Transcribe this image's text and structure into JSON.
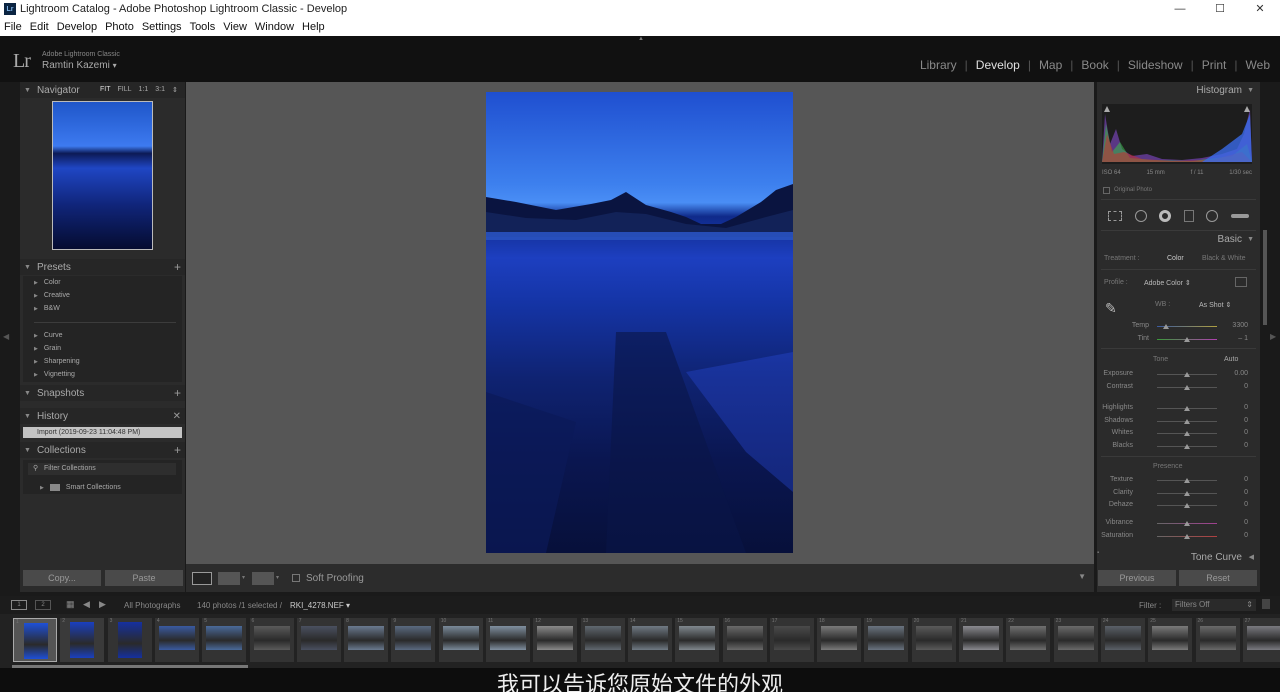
{
  "window": {
    "title": "Lightroom Catalog - Adobe Photoshop Lightroom Classic - Develop",
    "icon_label": "Lr",
    "controls": [
      "—",
      "☐",
      "✕"
    ]
  },
  "menu": [
    "File",
    "Edit",
    "Develop",
    "Photo",
    "Settings",
    "Tools",
    "View",
    "Window",
    "Help"
  ],
  "identity": {
    "logo": "Lr",
    "product": "Adobe Lightroom Classic",
    "user": "Ramtin Kazemi",
    "user_arrow": "▾"
  },
  "modules": {
    "items": [
      "Library",
      "Develop",
      "Map",
      "Book",
      "Slideshow",
      "Print",
      "Web"
    ],
    "active": "Develop"
  },
  "left": {
    "navigator": {
      "title": "Navigator",
      "zoom": [
        "FIT",
        "FILL",
        "1:1",
        "3:1"
      ],
      "zoom_arrow": "⇕"
    },
    "presets": {
      "title": "Presets",
      "groups_a": [
        "Color",
        "Creative",
        "B&W"
      ],
      "groups_b": [
        "Curve",
        "Grain",
        "Sharpening",
        "Vignetting"
      ]
    },
    "snapshots": {
      "title": "Snapshots"
    },
    "history": {
      "title": "History",
      "item": "Import (2019-09-23 11:04:48 PM)"
    },
    "collections": {
      "title": "Collections",
      "filter": "Filter Collections",
      "smart": "Smart Collections"
    },
    "copy": "Copy...",
    "paste": "Paste"
  },
  "toolbar": {
    "soft_proofing": "Soft Proofing"
  },
  "right": {
    "histogram": {
      "title": "Histogram",
      "iso": "ISO 64",
      "focal": "15 mm",
      "aperture": "f / 11",
      "shutter": "1/30 sec",
      "original": "Original Photo"
    },
    "basic": {
      "title": "Basic",
      "treatment_label": "Treatment :",
      "color": "Color",
      "bw": "Black & White",
      "profile_label": "Profile :",
      "profile": "Adobe Color",
      "wb_label": "WB :",
      "wb": "As Shot",
      "temp": {
        "label": "Temp",
        "value": "3300"
      },
      "tint": {
        "label": "Tint",
        "value": "– 1"
      },
      "tone": "Tone",
      "auto": "Auto",
      "exposure": {
        "label": "Exposure",
        "value": "0.00"
      },
      "contrast": {
        "label": "Contrast",
        "value": "0"
      },
      "highlights": {
        "label": "Highlights",
        "value": "0"
      },
      "shadows": {
        "label": "Shadows",
        "value": "0"
      },
      "whites": {
        "label": "Whites",
        "value": "0"
      },
      "blacks": {
        "label": "Blacks",
        "value": "0"
      },
      "presence": "Presence",
      "texture": {
        "label": "Texture",
        "value": "0"
      },
      "clarity": {
        "label": "Clarity",
        "value": "0"
      },
      "dehaze": {
        "label": "Dehaze",
        "value": "0"
      },
      "vibrance": {
        "label": "Vibrance",
        "value": "0"
      },
      "saturation": {
        "label": "Saturation",
        "value": "0"
      }
    },
    "tone_curve": "Tone Curve",
    "previous": "Previous",
    "reset": "Reset"
  },
  "filmbar": {
    "screen1": "1",
    "screen2": "2",
    "source": "All Photographs",
    "count": "140 photos /1 selected /",
    "filename": "RKI_4278.NEF",
    "filter_label": "Filter :",
    "filter_value": "Filters Off"
  },
  "filmstrip_numbers": [
    "1",
    "2",
    "3",
    "4",
    "5",
    "6",
    "7",
    "8",
    "9",
    "10",
    "11",
    "12",
    "13",
    "14",
    "15",
    "16",
    "17",
    "18",
    "19",
    "20",
    "21",
    "22",
    "23",
    "24",
    "25",
    "26",
    "27"
  ],
  "subtitle": "我可以告诉您原始文件的外观"
}
